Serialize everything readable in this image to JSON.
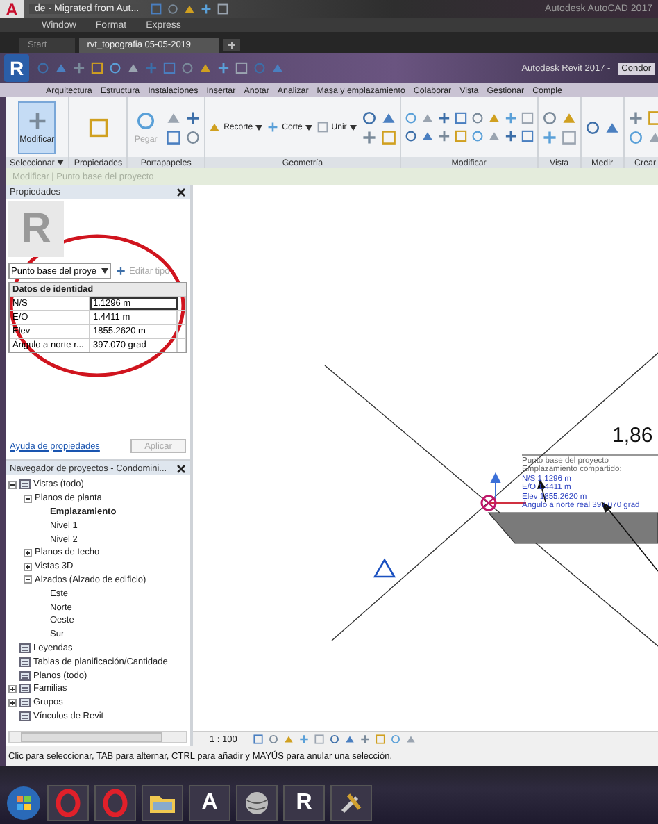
{
  "app_titlebar": {
    "logo": "A",
    "title": "de - Migrated from Aut...",
    "app_name": "Autodesk AutoCAD 2017"
  },
  "menu": [
    "Window",
    "Format",
    "Express"
  ],
  "file_tabs": [
    {
      "label": "Start",
      "selected": false
    },
    {
      "label": "rvt_topografia 05-05-2019",
      "selected": true
    }
  ],
  "revit_titlebar": {
    "logo": "R",
    "title": "Autodesk Revit 2017 -",
    "project": "Condor"
  },
  "ribbon_tabs": [
    "Arquitectura",
    "Estructura",
    "Instalaciones",
    "Insertar",
    "Anotar",
    "Analizar",
    "Masa y emplazamiento",
    "Colaborar",
    "Vista",
    "Gestionar",
    "Comple"
  ],
  "ribbon_panels": [
    {
      "label": "Seleccionar",
      "dropdown": true,
      "tools": [
        {
          "kind": "big",
          "label": "Modificar",
          "selected": true
        }
      ]
    },
    {
      "label": "Propiedades",
      "dropdown": false,
      "tools": [
        {
          "kind": "big",
          "selected": false
        }
      ]
    },
    {
      "label": "Portapapeles",
      "dropdown": false,
      "tools": [
        {
          "kind": "big",
          "label": "Pegar",
          "disabled": true
        }
      ]
    },
    {
      "label": "Geometría",
      "dropdown": false,
      "tools": [
        {
          "kind": "small",
          "label": "Recorte"
        },
        {
          "kind": "small",
          "label": "Corte"
        },
        {
          "kind": "small",
          "label": "Unir"
        }
      ]
    },
    {
      "label": "Modificar",
      "dropdown": false
    },
    {
      "label": "Vista",
      "dropdown": false
    },
    {
      "label": "Medir",
      "dropdown": false
    },
    {
      "label": "Crear",
      "dropdown": false
    }
  ],
  "context_bar": "Modificar | Punto base del proyecto",
  "properties": {
    "title": "Propiedades",
    "image_letter": "R",
    "type_selector": "Punto base del proye",
    "edit_type": {
      "label": "Editar tipo",
      "disabled": true
    },
    "group": "Datos de identidad",
    "rows": [
      {
        "label": "N/S",
        "value": "1.1296 m",
        "active": true
      },
      {
        "label": "E/O",
        "value": "1.4411 m",
        "active": false
      },
      {
        "label": "Elev",
        "value": "1855.2620 m",
        "active": false
      },
      {
        "label": "Ángulo a norte r...",
        "value": "397.070 grad",
        "active": false
      }
    ],
    "help_link": "Ayuda de propiedades",
    "apply": {
      "label": "Aplicar",
      "disabled": true
    }
  },
  "project_browser": {
    "title": "Navegador de proyectos - Condomini...",
    "tree": [
      {
        "label": "Vistas (todo)",
        "expanded": true,
        "selected": false,
        "children": [
          {
            "label": "Planos de planta",
            "expanded": true,
            "selected": false,
            "children": [
              {
                "label": "Emplazamiento",
                "selected": true
              },
              {
                "label": "Nivel 1",
                "selected": false
              },
              {
                "label": "Nivel 2",
                "selected": false
              }
            ]
          },
          {
            "label": "Planos de techo",
            "expanded": false,
            "selected": false
          },
          {
            "label": "Vistas 3D",
            "expanded": false,
            "selected": false
          },
          {
            "label": "Alzados (Alzado de edificio)",
            "expanded": true,
            "selected": false,
            "children": [
              {
                "label": "Este",
                "selected": false
              },
              {
                "label": "Norte",
                "selected": false
              },
              {
                "label": "Oeste",
                "selected": false
              },
              {
                "label": "Sur",
                "selected": false
              }
            ]
          }
        ]
      },
      {
        "label": "Leyendas",
        "selected": false
      },
      {
        "label": "Tablas de planificación/Cantidade",
        "selected": false
      },
      {
        "label": "Planos (todo)",
        "selected": false
      },
      {
        "label": "Familias",
        "expanded": false,
        "selected": false
      },
      {
        "label": "Grupos",
        "expanded": false,
        "selected": false
      },
      {
        "label": "Vínculos de Revit",
        "selected": false
      }
    ]
  },
  "canvas": {
    "dimension": "1,86",
    "label_lines": [
      {
        "kind": "heading",
        "text": "Punto base del proyecto"
      },
      {
        "kind": "heading",
        "text": "Emplazamiento compartido:"
      },
      {
        "kind": "value",
        "text": "N/S  1.1296 m"
      },
      {
        "kind": "value",
        "text": "E/O  1.4411 m"
      },
      {
        "kind": "value",
        "text": "Elev  1855.2620 m"
      },
      {
        "kind": "value",
        "text": "Ángulo a norte real  397.070 grad"
      }
    ],
    "scale": "1 : 100"
  },
  "status_bar": "Clic para seleccionar, TAB para alternar, CTRL para añadir y MAYÚS para anular una selección.",
  "taskbar": [
    {
      "kind": "start"
    },
    {
      "kind": "ring"
    },
    {
      "kind": "ring"
    },
    {
      "kind": "folder"
    },
    {
      "kind": "letter",
      "text": "A"
    },
    {
      "kind": "globe"
    },
    {
      "kind": "letter",
      "text": "R"
    },
    {
      "kind": "tools"
    }
  ]
}
